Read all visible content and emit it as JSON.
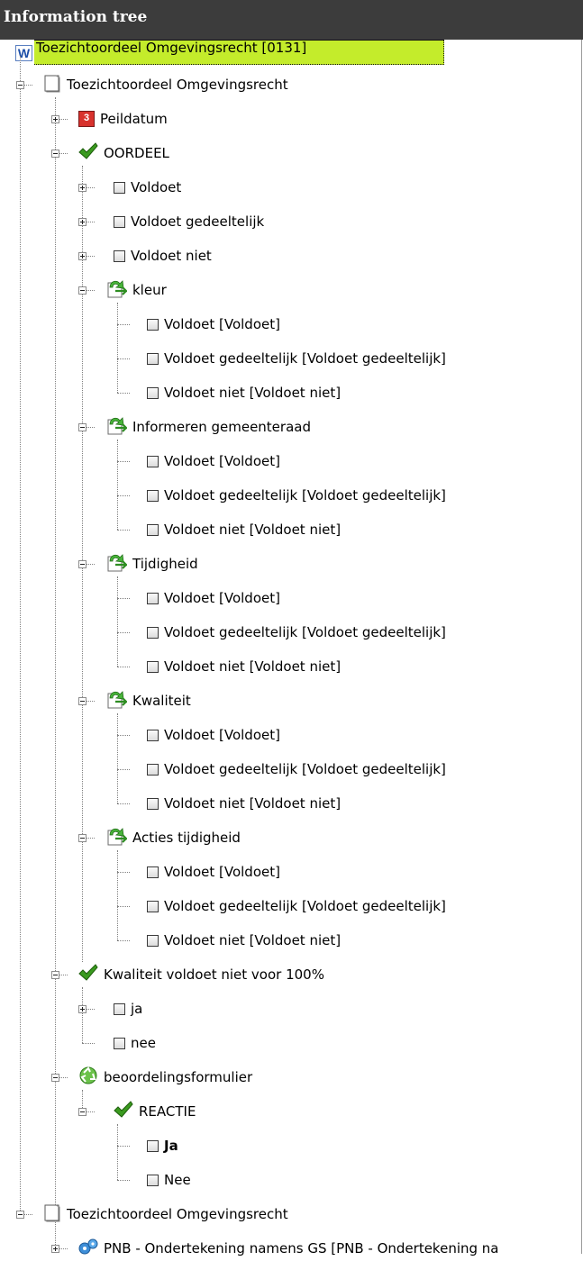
{
  "panel": {
    "title": "Information tree"
  },
  "root_document": {
    "label": "Toezichtoordeel Omgevingsrecht [0131]",
    "icon": "word-document-icon"
  },
  "tree": [
    {
      "label": "Toezichtoordeel Omgevingsrecht",
      "icon": "document-icon",
      "expander": "minus"
    },
    {
      "label": "Peildatum",
      "icon": "calendar-icon",
      "expander": "plus"
    },
    {
      "label": "OORDEEL",
      "icon": "checkmark-icon",
      "expander": "minus"
    },
    {
      "label": "Voldoet",
      "icon": "checkbox-icon",
      "expander": "plus"
    },
    {
      "label": "Voldoet gedeeltelijk",
      "icon": "checkbox-icon",
      "expander": "plus"
    },
    {
      "label": "Voldoet niet",
      "icon": "checkbox-icon",
      "expander": "plus"
    },
    {
      "label": "kleur",
      "icon": "arrow-page-icon",
      "expander": "minus"
    },
    {
      "label": "Voldoet [Voldoet]",
      "icon": "checkbox-icon",
      "expander": "none"
    },
    {
      "label": "Voldoet gedeeltelijk [Voldoet gedeeltelijk]",
      "icon": "checkbox-icon",
      "expander": "none"
    },
    {
      "label": "Voldoet niet [Voldoet niet]",
      "icon": "checkbox-icon",
      "expander": "none"
    },
    {
      "label": "Informeren gemeenteraad",
      "icon": "arrow-page-icon",
      "expander": "minus"
    },
    {
      "label": "Voldoet [Voldoet]",
      "icon": "checkbox-icon",
      "expander": "none"
    },
    {
      "label": "Voldoet gedeeltelijk [Voldoet gedeeltelijk]",
      "icon": "checkbox-icon",
      "expander": "none"
    },
    {
      "label": "Voldoet niet [Voldoet niet]",
      "icon": "checkbox-icon",
      "expander": "none"
    },
    {
      "label": "Tijdigheid",
      "icon": "arrow-page-icon",
      "expander": "minus"
    },
    {
      "label": "Voldoet [Voldoet]",
      "icon": "checkbox-icon",
      "expander": "none"
    },
    {
      "label": "Voldoet gedeeltelijk [Voldoet gedeeltelijk]",
      "icon": "checkbox-icon",
      "expander": "none"
    },
    {
      "label": "Voldoet niet [Voldoet niet]",
      "icon": "checkbox-icon",
      "expander": "none"
    },
    {
      "label": "Kwaliteit",
      "icon": "arrow-page-icon",
      "expander": "minus"
    },
    {
      "label": "Voldoet [Voldoet]",
      "icon": "checkbox-icon",
      "expander": "none"
    },
    {
      "label": "Voldoet gedeeltelijk [Voldoet gedeeltelijk]",
      "icon": "checkbox-icon",
      "expander": "none"
    },
    {
      "label": "Voldoet niet [Voldoet niet]",
      "icon": "checkbox-icon",
      "expander": "none"
    },
    {
      "label": "Acties tijdigheid",
      "icon": "arrow-page-icon",
      "expander": "minus"
    },
    {
      "label": "Voldoet [Voldoet]",
      "icon": "checkbox-icon",
      "expander": "none"
    },
    {
      "label": "Voldoet gedeeltelijk [Voldoet gedeeltelijk]",
      "icon": "checkbox-icon",
      "expander": "none"
    },
    {
      "label": "Voldoet niet [Voldoet niet]",
      "icon": "checkbox-icon",
      "expander": "none"
    },
    {
      "label": "Kwaliteit voldoet niet voor 100%",
      "icon": "checkmark-icon",
      "expander": "minus"
    },
    {
      "label": "ja",
      "icon": "checkbox-icon",
      "expander": "plus"
    },
    {
      "label": "nee",
      "icon": "checkbox-icon",
      "expander": "none"
    },
    {
      "label": "beoordelingsformulier",
      "icon": "recycle-icon",
      "expander": "minus"
    },
    {
      "label": "REACTIE",
      "icon": "checkmark-icon",
      "expander": "minus"
    },
    {
      "label": "Ja",
      "icon": "checkbox-icon",
      "expander": "none",
      "bold": true
    },
    {
      "label": "Nee",
      "icon": "checkbox-icon",
      "expander": "none"
    },
    {
      "label": "Toezichtoordeel Omgevingsrecht",
      "icon": "document-icon",
      "expander": "minus"
    },
    {
      "label": "PNB - Ondertekening namens GS [PNB - Ondertekening na",
      "icon": "gear-icon",
      "expander": "plus"
    }
  ],
  "colors": {
    "title_bar": "#3c3c3c",
    "root_highlight": "#c4ec2b",
    "check_green": "#3a9a1f"
  }
}
